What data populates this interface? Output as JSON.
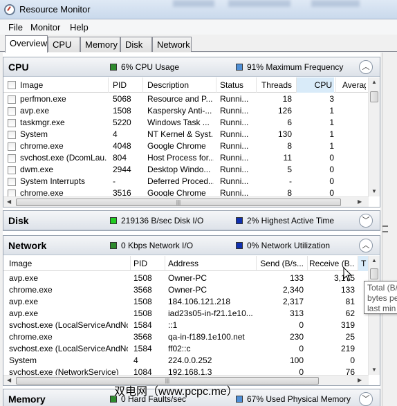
{
  "window": {
    "title": "Resource Monitor",
    "icon": "resource-monitor-icon"
  },
  "menu": {
    "file": "File",
    "monitor": "Monitor",
    "help": "Help"
  },
  "tabs": [
    "Overview",
    "CPU",
    "Memory",
    "Disk",
    "Network"
  ],
  "cpu": {
    "title": "CPU",
    "usage": "6% CPU Usage",
    "usage_color": "#2e8b2e",
    "frequency": "91% Maximum Frequency",
    "frequency_color": "#4f8fd6",
    "columns": [
      "Image",
      "PID",
      "Description",
      "Status",
      "Threads",
      "CPU",
      "Averag"
    ],
    "rows": [
      [
        "perfmon.exe",
        "5068",
        "Resource and P...",
        "Runni...",
        "18",
        "3"
      ],
      [
        "avp.exe",
        "1508",
        "Kaspersky Anti-...",
        "Runni...",
        "126",
        "1"
      ],
      [
        "taskmgr.exe",
        "5220",
        "Windows Task ...",
        "Runni...",
        "6",
        "1"
      ],
      [
        "System",
        "4",
        "NT Kernel & Syst...",
        "Runni...",
        "130",
        "1"
      ],
      [
        "chrome.exe",
        "4048",
        "Google Chrome",
        "Runni...",
        "8",
        "1"
      ],
      [
        "svchost.exe (DcomLau...",
        "804",
        "Host Process for...",
        "Runni...",
        "11",
        "0"
      ],
      [
        "dwm.exe",
        "2944",
        "Desktop Windo...",
        "Runni...",
        "5",
        "0"
      ],
      [
        "System Interrupts",
        "-",
        "Deferred Proced...",
        "Runni...",
        "-",
        "0"
      ],
      [
        "chrome.exe",
        "3516",
        "Google Chrome",
        "Runni...",
        "8",
        "0"
      ]
    ]
  },
  "disk": {
    "title": "Disk",
    "io": "219136 B/sec Disk I/O",
    "io_color": "#22cc22",
    "active": "2% Highest Active Time",
    "active_color": "#1030b0"
  },
  "network": {
    "title": "Network",
    "io": "0 Kbps Network I/O",
    "io_color": "#2e8b2e",
    "utilization": "0% Network Utilization",
    "utilization_color": "#1030b0",
    "columns": [
      "Image",
      "PID",
      "Address",
      "Send (B/s...",
      "Receive (B...",
      "T"
    ],
    "rows": [
      [
        "avp.exe",
        "1508",
        "Owner-PC",
        "133",
        "3,175"
      ],
      [
        "chrome.exe",
        "3568",
        "Owner-PC",
        "2,340",
        "133"
      ],
      [
        "avp.exe",
        "1508",
        "184.106.121.218",
        "2,317",
        "81"
      ],
      [
        "avp.exe",
        "1508",
        "iad23s05-in-f21.1e10...",
        "313",
        "62"
      ],
      [
        "svchost.exe (LocalServiceAndNo...",
        "1584",
        "::1",
        "0",
        "319"
      ],
      [
        "chrome.exe",
        "3568",
        "qa-in-f189.1e100.net",
        "230",
        "25"
      ],
      [
        "svchost.exe (LocalServiceAndNo...",
        "1584",
        "ff02::c",
        "0",
        "219"
      ],
      [
        "System",
        "4",
        "224.0.0.252",
        "100",
        "0"
      ],
      [
        "svchost.exe (NetworkService)",
        "1084",
        "192.168.1.3",
        "0",
        "76"
      ]
    ],
    "tooltip": [
      "Total (B/",
      "bytes pe",
      "last min"
    ]
  },
  "memory": {
    "title": "Memory",
    "faults": "0 Hard Faults/sec",
    "faults_color": "#2e8b2e",
    "used": "67% Used Physical Memory",
    "used_color": "#4f8fd6"
  },
  "watermark": "双电网（www.pcpc.me）"
}
